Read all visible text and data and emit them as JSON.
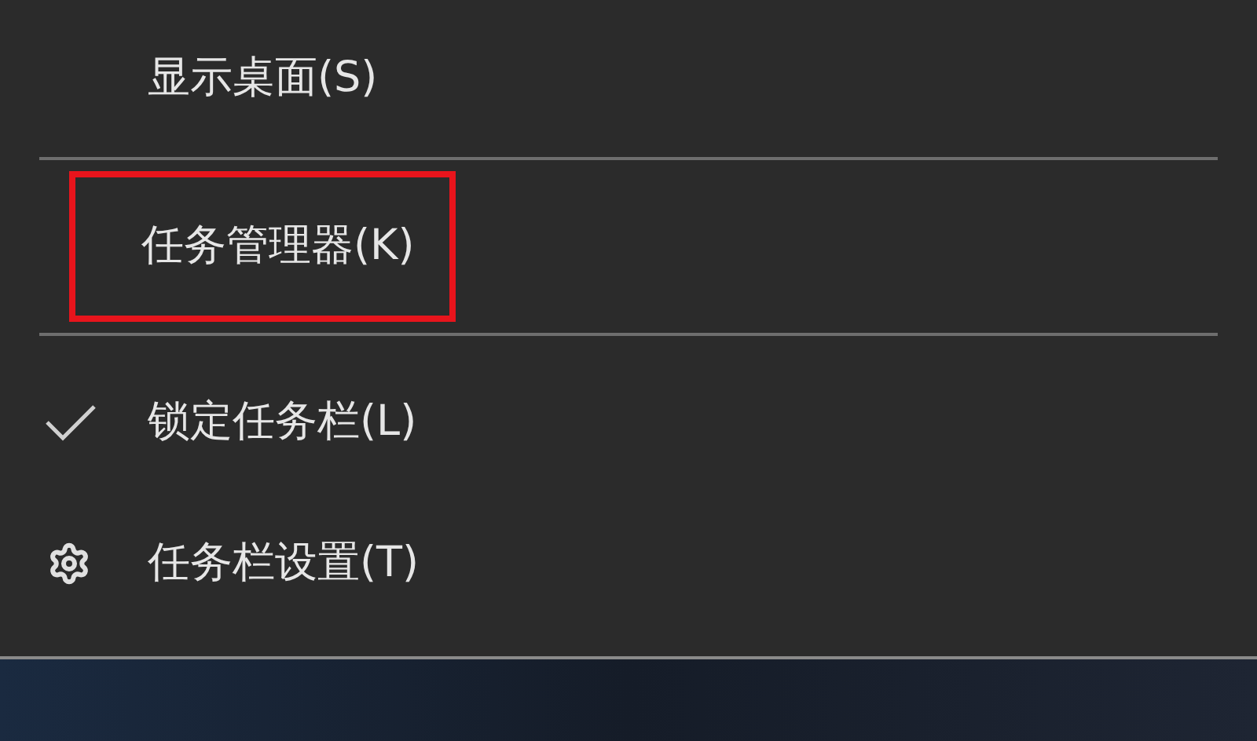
{
  "menu": {
    "items": [
      {
        "kind": "item",
        "label": "显示桌面(S)",
        "checked": false,
        "highlighted": false
      },
      {
        "kind": "separator"
      },
      {
        "kind": "item",
        "label": "任务管理器(K)",
        "checked": false,
        "highlighted": true
      },
      {
        "kind": "separator"
      },
      {
        "kind": "item",
        "label": "锁定任务栏(L)",
        "checked": true,
        "highlighted": false
      },
      {
        "kind": "settings",
        "label": "任务栏设置(T)",
        "checked": false,
        "highlighted": false
      }
    ]
  }
}
